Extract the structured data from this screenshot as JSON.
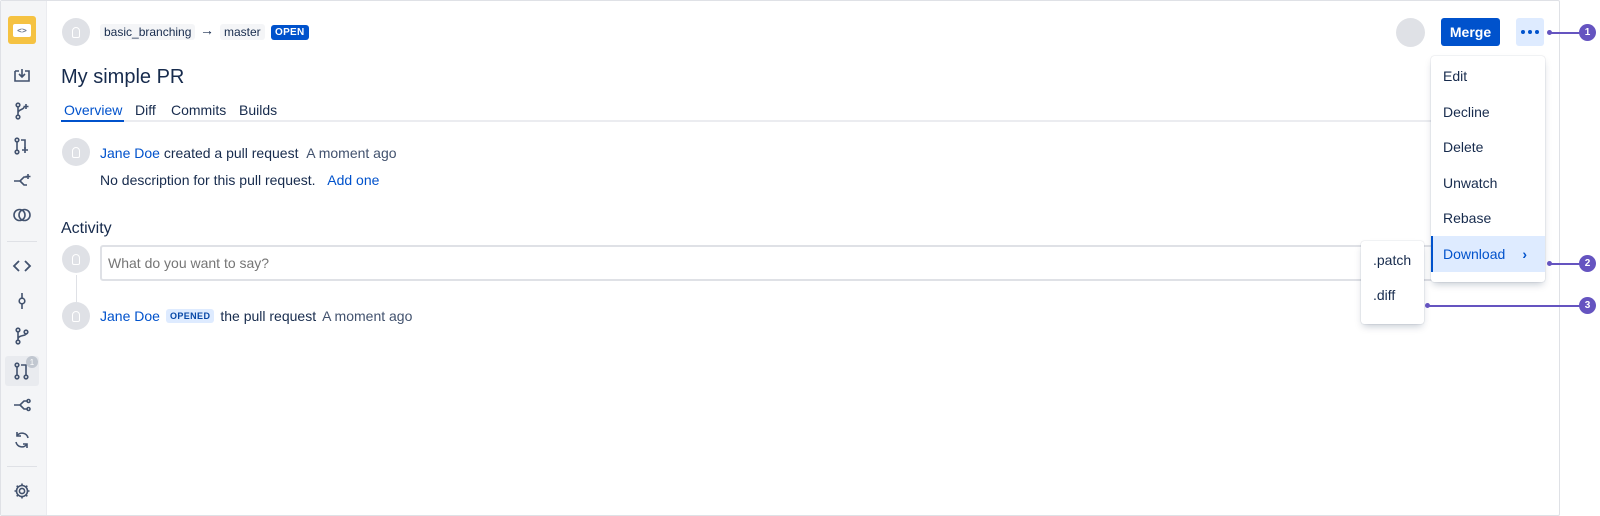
{
  "sidebar": {
    "logo_icon": "code-repository-icon",
    "items": [
      {
        "icon": "clone-download-icon"
      },
      {
        "icon": "create-branch-icon"
      },
      {
        "icon": "create-pull-request-icon"
      },
      {
        "icon": "fork-icon"
      },
      {
        "icon": "compare-icon"
      },
      {
        "icon": "source-code-icon"
      },
      {
        "icon": "commits-icon"
      },
      {
        "icon": "branches-icon"
      },
      {
        "icon": "pull-requests-icon",
        "badge": "1"
      },
      {
        "icon": "forks-icon"
      },
      {
        "icon": "builds-sync-icon"
      },
      {
        "icon": "settings-gear-icon"
      }
    ]
  },
  "header": {
    "source_branch": "basic_branching",
    "arrow": "→",
    "target_branch": "master",
    "status": "OPEN",
    "merge_label": "Merge"
  },
  "pr": {
    "title": "My simple PR",
    "tabs": [
      "Overview",
      "Diff",
      "Commits",
      "Builds"
    ]
  },
  "overview": {
    "author": "Jane Doe",
    "action": "created a pull request",
    "time": "A moment ago",
    "no_description": "No description for this pull request.",
    "add_link": "Add one"
  },
  "activity": {
    "heading": "Activity",
    "comment_placeholder": "What do you want to say?",
    "event": {
      "author": "Jane Doe",
      "badge": "OPENED",
      "text": "the pull request",
      "time": "A moment ago"
    }
  },
  "menu": {
    "items": [
      "Edit",
      "Decline",
      "Delete",
      "Unwatch",
      "Rebase",
      "Download"
    ],
    "chevron": "›",
    "submenu": [
      ".patch",
      ".diff"
    ]
  },
  "callouts": [
    "1",
    "2",
    "3"
  ],
  "colors": {
    "primary": "#0052cc",
    "callout": "#6554c0",
    "logo": "#f5c242"
  }
}
